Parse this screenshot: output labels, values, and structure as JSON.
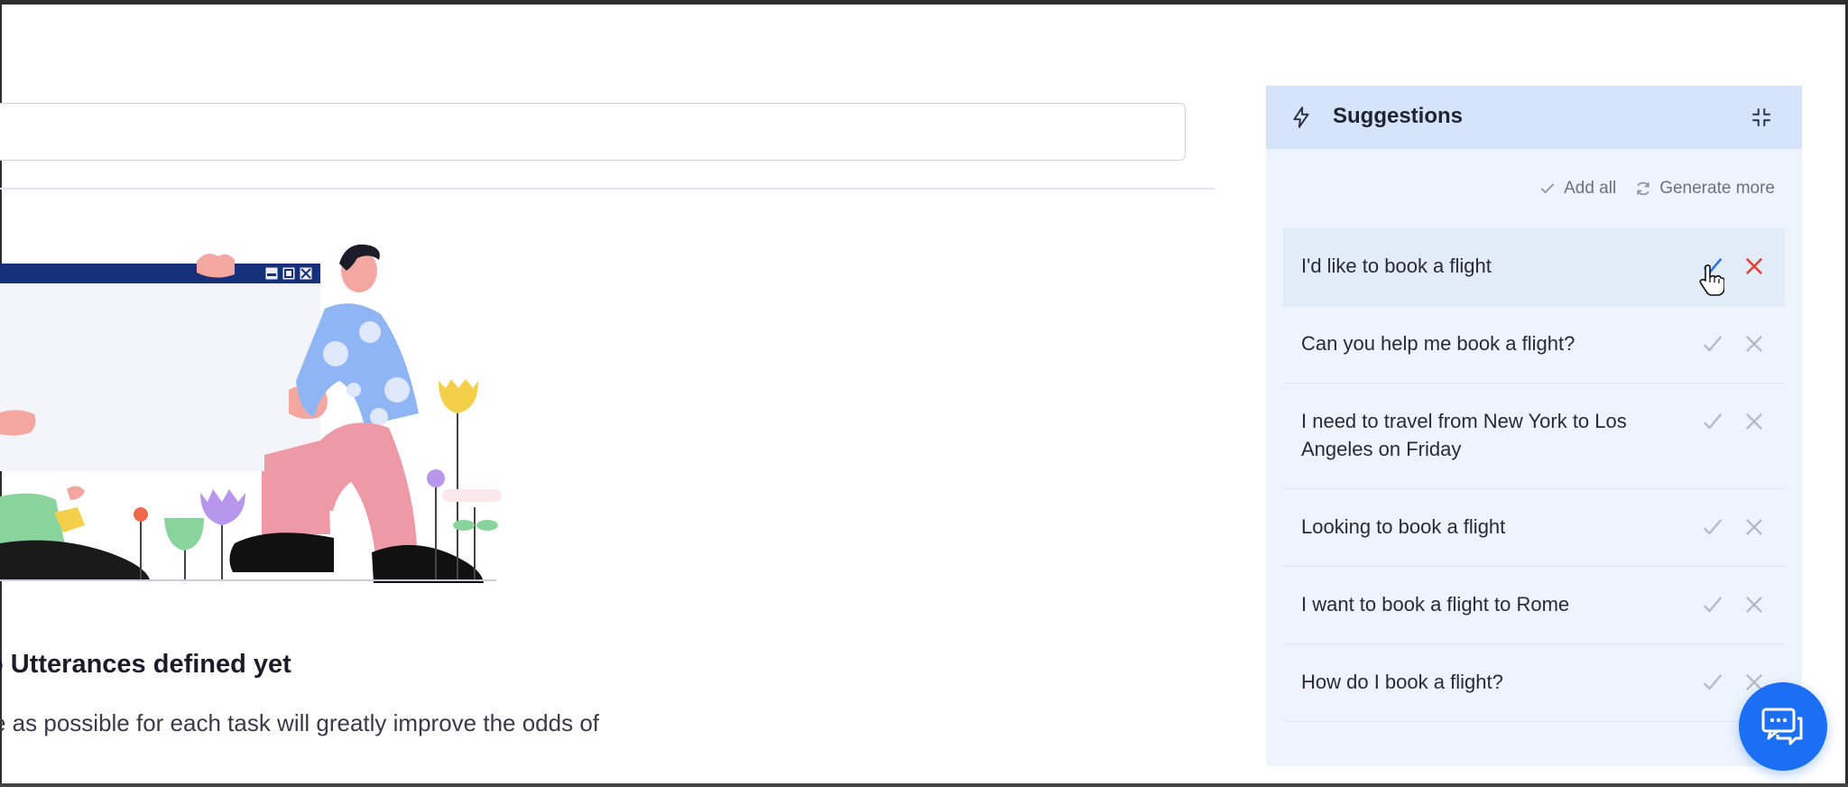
{
  "empty_state": {
    "title": "o Utterances defined yet",
    "description": "e as possible for each task will greatly improve the odds of"
  },
  "suggestions": {
    "title": "Suggestions",
    "add_all_label": "Add all",
    "generate_more_label": "Generate more",
    "items": [
      {
        "text": "I'd like to book a flight"
      },
      {
        "text": "Can you help me book a flight?"
      },
      {
        "text": "I need to travel from New York to Los Angeles on Friday"
      },
      {
        "text": "Looking to book a flight"
      },
      {
        "text": "I want to book a flight to Rome"
      },
      {
        "text": "How do I book a flight?"
      }
    ]
  },
  "colors": {
    "accent": "#1a6ff5",
    "panel_bg": "#eef4fd",
    "header_bg": "#d6e4fb",
    "reject_active": "#e0413a",
    "accept_active": "#2f6fe0"
  }
}
